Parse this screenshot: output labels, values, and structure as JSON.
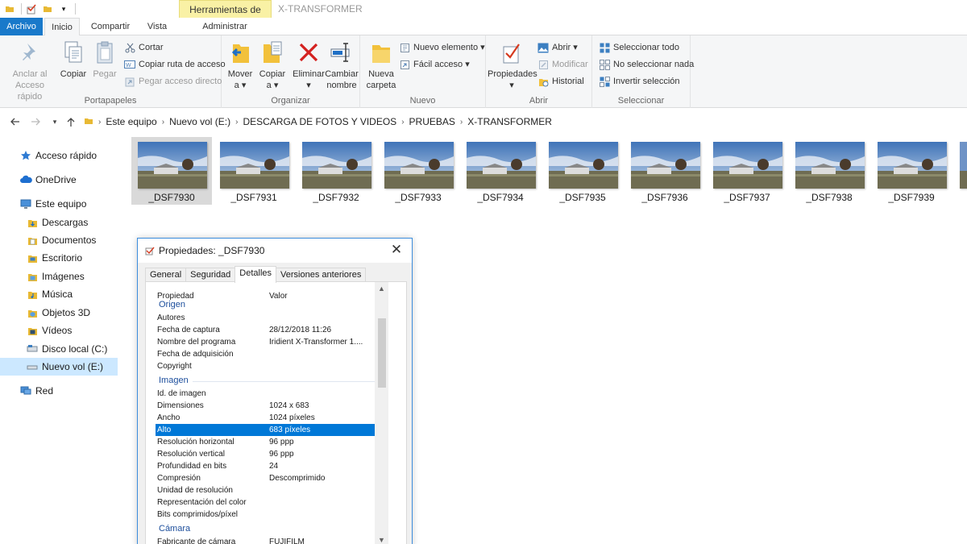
{
  "window": {
    "title": "X-TRANSFORMER",
    "context_tab": "Herramientas de imagen"
  },
  "ribbon_tabs": [
    {
      "label": "Archivo"
    },
    {
      "label": "Inicio"
    },
    {
      "label": "Compartir"
    },
    {
      "label": "Vista"
    },
    {
      "label": "Administrar"
    }
  ],
  "ribbon": {
    "portapapeles": {
      "label": "Portapapeles",
      "anclar": "Anclar al\nAcceso rápido",
      "copiar": "Copiar",
      "pegar": "Pegar",
      "cortar": "Cortar",
      "copiar_ruta": "Copiar ruta de acceso",
      "pegar_acceso": "Pegar acceso directo"
    },
    "organizar": {
      "label": "Organizar",
      "mover": "Mover\na ▾",
      "copiar_a": "Copiar\na ▾",
      "eliminar": "Eliminar\n▾",
      "cambiar": "Cambiar\nnombre"
    },
    "nuevo": {
      "label": "Nuevo",
      "nueva_carpeta": "Nueva\ncarpeta",
      "nuevo_elemento": "Nuevo elemento ▾",
      "facil_acceso": "Fácil acceso ▾"
    },
    "abrir": {
      "label": "Abrir",
      "propiedades": "Propiedades\n▾",
      "abrir": "Abrir ▾",
      "modificar": "Modificar",
      "historial": "Historial"
    },
    "seleccionar": {
      "label": "Seleccionar",
      "todo": "Seleccionar todo",
      "ninguno": "No seleccionar nada",
      "invertir": "Invertir selección"
    }
  },
  "breadcrumbs": [
    "Este equipo",
    "Nuevo vol (E:)",
    "DESCARGA DE FOTOS Y VIDEOS",
    "PRUEBAS",
    "X-TRANSFORMER"
  ],
  "sidebar": {
    "items": [
      {
        "label": "Acceso rápido",
        "icon": "star-icon"
      },
      {
        "label": "OneDrive",
        "icon": "cloud-icon"
      },
      {
        "label": "Este equipo",
        "icon": "computer-icon"
      },
      {
        "label": "Descargas",
        "icon": "download-folder-icon"
      },
      {
        "label": "Documentos",
        "icon": "documents-folder-icon"
      },
      {
        "label": "Escritorio",
        "icon": "desktop-folder-icon"
      },
      {
        "label": "Imágenes",
        "icon": "pictures-folder-icon"
      },
      {
        "label": "Música",
        "icon": "music-folder-icon"
      },
      {
        "label": "Objetos 3D",
        "icon": "3d-objects-folder-icon"
      },
      {
        "label": "Vídeos",
        "icon": "videos-folder-icon"
      },
      {
        "label": "Disco local (C:)",
        "icon": "drive-icon"
      },
      {
        "label": "Nuevo vol (E:)",
        "icon": "drive-icon"
      },
      {
        "label": "Red",
        "icon": "network-icon"
      }
    ]
  },
  "files": [
    {
      "name": "_DSF7930"
    },
    {
      "name": "_DSF7931"
    },
    {
      "name": "_DSF7932"
    },
    {
      "name": "_DSF7933"
    },
    {
      "name": "_DSF7934"
    },
    {
      "name": "_DSF7935"
    },
    {
      "name": "_DSF7936"
    },
    {
      "name": "_DSF7937"
    },
    {
      "name": "_DSF7938"
    },
    {
      "name": "_DSF7939"
    }
  ],
  "dialog": {
    "title": "Propiedades: _DSF7930",
    "tabs": [
      "General",
      "Seguridad",
      "Detalles",
      "Versiones anteriores"
    ],
    "col_property": "Propiedad",
    "col_value": "Valor",
    "rows": [
      {
        "type": "header",
        "name": "Origen"
      },
      {
        "name": "Autores",
        "value": ""
      },
      {
        "name": "Fecha de captura",
        "value": "28/12/2018 11:26"
      },
      {
        "name": "Nombre del programa",
        "value": "Iridient X-Transformer 1...."
      },
      {
        "name": "Fecha de adquisición",
        "value": ""
      },
      {
        "name": "Copyright",
        "value": ""
      },
      {
        "type": "header",
        "name": "Imagen"
      },
      {
        "name": "Id. de imagen",
        "value": ""
      },
      {
        "name": "Dimensiones",
        "value": "1024 x 683"
      },
      {
        "name": "Ancho",
        "value": "1024 píxeles"
      },
      {
        "name": "Alto",
        "value": "683 píxeles",
        "selected": true
      },
      {
        "name": "Resolución horizontal",
        "value": "96 ppp"
      },
      {
        "name": "Resolución vertical",
        "value": "96 ppp"
      },
      {
        "name": "Profundidad en bits",
        "value": "24"
      },
      {
        "name": "Compresión",
        "value": "Descomprimido"
      },
      {
        "name": "Unidad de resolución",
        "value": ""
      },
      {
        "name": "Representación del color",
        "value": ""
      },
      {
        "name": "Bits comprimidos/píxel",
        "value": ""
      },
      {
        "type": "header",
        "name": "Cámara"
      },
      {
        "name": "Fabricante de cámara",
        "value": "FUJIFILM"
      }
    ]
  },
  "colors": {
    "accent": "#1979ca",
    "selection": "#0078d7",
    "sidebar_selection": "#cce8ff",
    "context_tab": "#f9f1a5"
  }
}
